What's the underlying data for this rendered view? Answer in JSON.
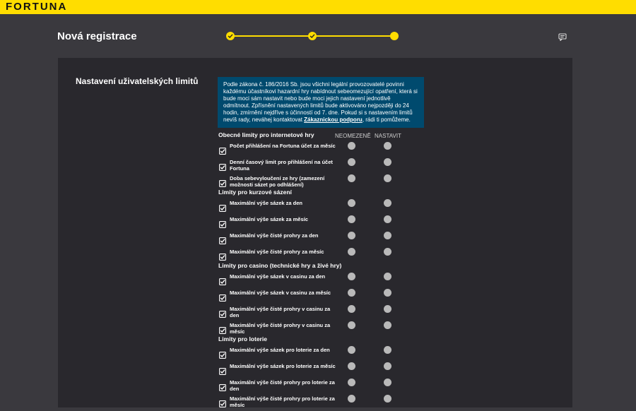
{
  "brand": {
    "logo": "FORTUNA"
  },
  "header": {
    "title": "Nová registrace"
  },
  "panel": {
    "heading": "Nastavení uživatelských limitů",
    "info": {
      "text": "Podle zákona č. 186/2016 Sb. jsou všichni legální provozovatelé povinni každému účastníkovi hazardní hry nabídnout sebeomezující opatření, která si bude moci sám nastavit nebo bude moci jejich nastavení jednotlivě odmítnout. Zpřísnění nastavených limitů bude aktivováno nejpozději do 24 hodin, zmírnění nejdříve s účinností od 7. dne. Pokud si s nastavením limitů nevíš rady, neváhej kontaktovat ",
      "link": "Zákaznickou podporu",
      "suffix": ", rádi ti pomůžeme."
    },
    "columns": {
      "unlimited": "NEOMEZENĚ",
      "set": "NASTAVIT"
    },
    "groups": [
      {
        "title": "Obecné limity pro internetové hry",
        "items": [
          "Počet přihlášení na Fortuna účet za měsíc",
          "Denní časový limit pro přihlášení na účet Fortuna",
          "Doba sebevyloučení ze hry (zamezení možnosti sázet po odhlášení)"
        ]
      },
      {
        "title": "Limity pro kurzové sázení",
        "items": [
          "Maximální výše sázek za den",
          "Maximální výše sázek za měsíc",
          "Maximální výše čisté prohry za den",
          "Maximální výše čisté prohry za měsíc"
        ]
      },
      {
        "title": "Limity pro casino (technické hry a živé hry)",
        "items": [
          "Maximální výše sázek v casinu za den",
          "Maximální výše sázek v casinu za měsíc",
          "Maximální výše čisté prohry v casinu za den",
          "Maximální výše čisté prohry v casinu za měsíc"
        ]
      },
      {
        "title": "Limity pro loterie",
        "items": [
          "Maximální výše sázek pro loterie za den",
          "Maximální výše sázek pro loterie za měsíc",
          "Maximální výše čisté prohry pro loterie za den",
          "Maximální výše čisté prohry pro loterie za měsíc"
        ]
      }
    ]
  },
  "colors": {
    "accent": "#ffdd00",
    "info_bg": "#004a6e",
    "panel_bg": "#29282d",
    "page_bg": "#3a393e"
  },
  "icons": {
    "step_done": "check-icon",
    "help": "chat-icon",
    "row": "checkbox-checked-icon"
  }
}
